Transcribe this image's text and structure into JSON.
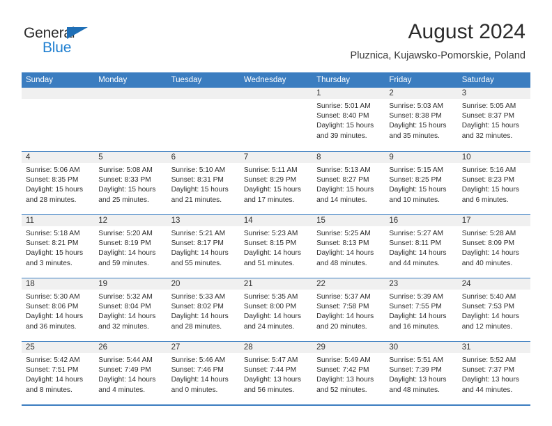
{
  "brand": {
    "word_general": "General",
    "word_blue": "Blue",
    "logo_icon": "triangle-icon",
    "accent_blue": "#1f7fd0",
    "header_blue": "#3b7dc0"
  },
  "header": {
    "month_title": "August 2024",
    "location": "Pluznica, Kujawsko-Pomorskie, Poland"
  },
  "calendar": {
    "weekdays": [
      "Sunday",
      "Monday",
      "Tuesday",
      "Wednesday",
      "Thursday",
      "Friday",
      "Saturday"
    ],
    "weeks": [
      [
        {
          "day": "",
          "sunrise": "",
          "sunset": "",
          "daylight": "",
          "empty": true
        },
        {
          "day": "",
          "sunrise": "",
          "sunset": "",
          "daylight": "",
          "empty": true
        },
        {
          "day": "",
          "sunrise": "",
          "sunset": "",
          "daylight": "",
          "empty": true
        },
        {
          "day": "",
          "sunrise": "",
          "sunset": "",
          "daylight": "",
          "empty": true
        },
        {
          "day": "1",
          "sunrise": "Sunrise: 5:01 AM",
          "sunset": "Sunset: 8:40 PM",
          "daylight": "Daylight: 15 hours and 39 minutes."
        },
        {
          "day": "2",
          "sunrise": "Sunrise: 5:03 AM",
          "sunset": "Sunset: 8:38 PM",
          "daylight": "Daylight: 15 hours and 35 minutes."
        },
        {
          "day": "3",
          "sunrise": "Sunrise: 5:05 AM",
          "sunset": "Sunset: 8:37 PM",
          "daylight": "Daylight: 15 hours and 32 minutes."
        }
      ],
      [
        {
          "day": "4",
          "sunrise": "Sunrise: 5:06 AM",
          "sunset": "Sunset: 8:35 PM",
          "daylight": "Daylight: 15 hours and 28 minutes."
        },
        {
          "day": "5",
          "sunrise": "Sunrise: 5:08 AM",
          "sunset": "Sunset: 8:33 PM",
          "daylight": "Daylight: 15 hours and 25 minutes."
        },
        {
          "day": "6",
          "sunrise": "Sunrise: 5:10 AM",
          "sunset": "Sunset: 8:31 PM",
          "daylight": "Daylight: 15 hours and 21 minutes."
        },
        {
          "day": "7",
          "sunrise": "Sunrise: 5:11 AM",
          "sunset": "Sunset: 8:29 PM",
          "daylight": "Daylight: 15 hours and 17 minutes."
        },
        {
          "day": "8",
          "sunrise": "Sunrise: 5:13 AM",
          "sunset": "Sunset: 8:27 PM",
          "daylight": "Daylight: 15 hours and 14 minutes."
        },
        {
          "day": "9",
          "sunrise": "Sunrise: 5:15 AM",
          "sunset": "Sunset: 8:25 PM",
          "daylight": "Daylight: 15 hours and 10 minutes."
        },
        {
          "day": "10",
          "sunrise": "Sunrise: 5:16 AM",
          "sunset": "Sunset: 8:23 PM",
          "daylight": "Daylight: 15 hours and 6 minutes."
        }
      ],
      [
        {
          "day": "11",
          "sunrise": "Sunrise: 5:18 AM",
          "sunset": "Sunset: 8:21 PM",
          "daylight": "Daylight: 15 hours and 3 minutes."
        },
        {
          "day": "12",
          "sunrise": "Sunrise: 5:20 AM",
          "sunset": "Sunset: 8:19 PM",
          "daylight": "Daylight: 14 hours and 59 minutes."
        },
        {
          "day": "13",
          "sunrise": "Sunrise: 5:21 AM",
          "sunset": "Sunset: 8:17 PM",
          "daylight": "Daylight: 14 hours and 55 minutes."
        },
        {
          "day": "14",
          "sunrise": "Sunrise: 5:23 AM",
          "sunset": "Sunset: 8:15 PM",
          "daylight": "Daylight: 14 hours and 51 minutes."
        },
        {
          "day": "15",
          "sunrise": "Sunrise: 5:25 AM",
          "sunset": "Sunset: 8:13 PM",
          "daylight": "Daylight: 14 hours and 48 minutes."
        },
        {
          "day": "16",
          "sunrise": "Sunrise: 5:27 AM",
          "sunset": "Sunset: 8:11 PM",
          "daylight": "Daylight: 14 hours and 44 minutes."
        },
        {
          "day": "17",
          "sunrise": "Sunrise: 5:28 AM",
          "sunset": "Sunset: 8:09 PM",
          "daylight": "Daylight: 14 hours and 40 minutes."
        }
      ],
      [
        {
          "day": "18",
          "sunrise": "Sunrise: 5:30 AM",
          "sunset": "Sunset: 8:06 PM",
          "daylight": "Daylight: 14 hours and 36 minutes."
        },
        {
          "day": "19",
          "sunrise": "Sunrise: 5:32 AM",
          "sunset": "Sunset: 8:04 PM",
          "daylight": "Daylight: 14 hours and 32 minutes."
        },
        {
          "day": "20",
          "sunrise": "Sunrise: 5:33 AM",
          "sunset": "Sunset: 8:02 PM",
          "daylight": "Daylight: 14 hours and 28 minutes."
        },
        {
          "day": "21",
          "sunrise": "Sunrise: 5:35 AM",
          "sunset": "Sunset: 8:00 PM",
          "daylight": "Daylight: 14 hours and 24 minutes."
        },
        {
          "day": "22",
          "sunrise": "Sunrise: 5:37 AM",
          "sunset": "Sunset: 7:58 PM",
          "daylight": "Daylight: 14 hours and 20 minutes."
        },
        {
          "day": "23",
          "sunrise": "Sunrise: 5:39 AM",
          "sunset": "Sunset: 7:55 PM",
          "daylight": "Daylight: 14 hours and 16 minutes."
        },
        {
          "day": "24",
          "sunrise": "Sunrise: 5:40 AM",
          "sunset": "Sunset: 7:53 PM",
          "daylight": "Daylight: 14 hours and 12 minutes."
        }
      ],
      [
        {
          "day": "25",
          "sunrise": "Sunrise: 5:42 AM",
          "sunset": "Sunset: 7:51 PM",
          "daylight": "Daylight: 14 hours and 8 minutes."
        },
        {
          "day": "26",
          "sunrise": "Sunrise: 5:44 AM",
          "sunset": "Sunset: 7:49 PM",
          "daylight": "Daylight: 14 hours and 4 minutes."
        },
        {
          "day": "27",
          "sunrise": "Sunrise: 5:46 AM",
          "sunset": "Sunset: 7:46 PM",
          "daylight": "Daylight: 14 hours and 0 minutes."
        },
        {
          "day": "28",
          "sunrise": "Sunrise: 5:47 AM",
          "sunset": "Sunset: 7:44 PM",
          "daylight": "Daylight: 13 hours and 56 minutes."
        },
        {
          "day": "29",
          "sunrise": "Sunrise: 5:49 AM",
          "sunset": "Sunset: 7:42 PM",
          "daylight": "Daylight: 13 hours and 52 minutes."
        },
        {
          "day": "30",
          "sunrise": "Sunrise: 5:51 AM",
          "sunset": "Sunset: 7:39 PM",
          "daylight": "Daylight: 13 hours and 48 minutes."
        },
        {
          "day": "31",
          "sunrise": "Sunrise: 5:52 AM",
          "sunset": "Sunset: 7:37 PM",
          "daylight": "Daylight: 13 hours and 44 minutes."
        }
      ]
    ]
  }
}
